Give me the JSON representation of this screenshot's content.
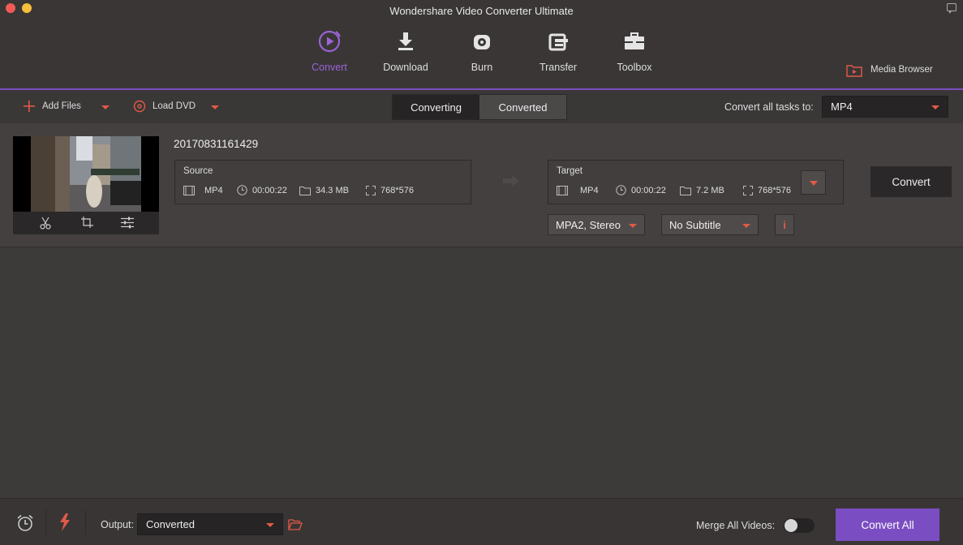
{
  "window": {
    "title": "Wondershare Video Converter Ultimate"
  },
  "nav": {
    "items": [
      {
        "label": "Convert",
        "icon": "convert-icon",
        "active": true
      },
      {
        "label": "Download",
        "icon": "download-icon"
      },
      {
        "label": "Burn",
        "icon": "burn-icon"
      },
      {
        "label": "Transfer",
        "icon": "transfer-icon"
      },
      {
        "label": "Toolbox",
        "icon": "toolbox-icon"
      }
    ],
    "media_browser": "Media Browser"
  },
  "toolbar": {
    "add_files": "Add Files",
    "load_dvd": "Load DVD",
    "tabs": [
      "Converting",
      "Converted"
    ],
    "convert_all_label": "Convert all tasks to:",
    "convert_all_format": "MP4"
  },
  "task": {
    "file_name": "20170831161429",
    "source": {
      "label": "Source",
      "format": "MP4",
      "duration": "00:00:22",
      "size": "34.3 MB",
      "resolution": "768*576"
    },
    "target": {
      "label": "Target",
      "format": "MP4",
      "duration": "00:00:22",
      "size": "7.2 MB",
      "resolution": "768*576"
    },
    "audio": "MPA2, Stereo",
    "subtitle": "No Subtitle",
    "info_glyph": "i",
    "convert_button": "Convert"
  },
  "bottom": {
    "output_label": "Output:",
    "output_value": "Converted",
    "merge_label": "Merge All Videos:",
    "merge_enabled": false,
    "convert_all": "Convert All"
  },
  "colors": {
    "accent": "#7b4dc2",
    "highlight": "#e05a47",
    "active_nav": "#9a63d6"
  }
}
